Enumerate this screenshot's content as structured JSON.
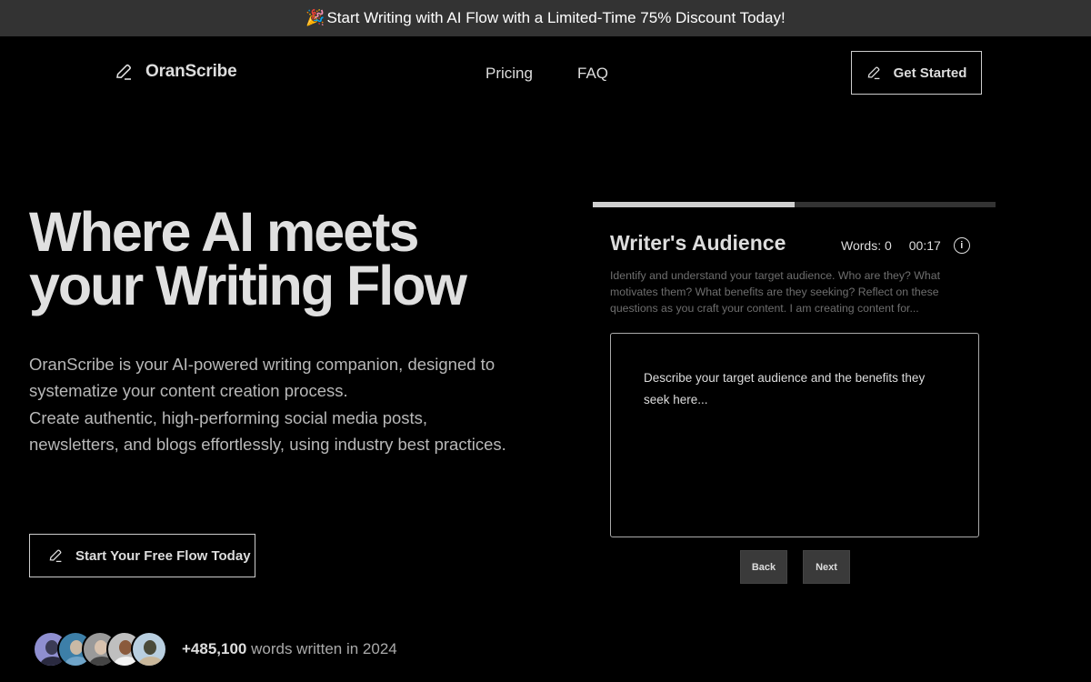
{
  "promo": {
    "emoji": "🎉",
    "text": "Start Writing with AI Flow with a Limited-Time 75% Discount Today!"
  },
  "nav": {
    "logo": "OranScribe",
    "links": [
      "Pricing",
      "FAQ"
    ],
    "cta": "Get Started"
  },
  "hero": {
    "title_line1": "Where AI meets",
    "title_line2": "your Writing Flow",
    "desc_line1": "OranScribe is your AI-powered writing companion, designed to systematize your content creation process.",
    "desc_line2": "Create authentic, high-performing social media posts, newsletters, and blogs effortlessly, using industry best practices.",
    "cta": "Start Your Free Flow Today"
  },
  "social_proof": {
    "count": "+485,100",
    "suffix": " words written in 2024",
    "avatars": [
      {
        "bg": "#8f8fd0",
        "head": "#3b3b55",
        "body": "#2a2a40"
      },
      {
        "bg": "#3d7fa8",
        "head": "#c9b9a5",
        "body": "#6fa4c8"
      },
      {
        "bg": "#9a9a9a",
        "head": "#d8c2ae",
        "body": "#444"
      },
      {
        "bg": "#bfbfbf",
        "head": "#8a5a3c",
        "body": "#f2f2f2"
      },
      {
        "bg": "#b9cfe0",
        "head": "#4a4a3a",
        "body": "#c9b79a"
      }
    ]
  },
  "writer_panel": {
    "progress_percent": 50,
    "colors": {
      "fill": "#d0d0d0",
      "track": "#333333"
    },
    "title": "Writer's Audience",
    "words_label": "Words: 0",
    "timer": "00:17",
    "info_icon": "i",
    "description": "Identify and understand your target audience. Who are they? What motivates them? What benefits are they seeking? Reflect on these questions as you craft your content. I am creating content for...",
    "editor_placeholder": "Describe your target audience and the benefits they seek here...",
    "editor_value": "",
    "back": "Back",
    "next": "Next"
  }
}
